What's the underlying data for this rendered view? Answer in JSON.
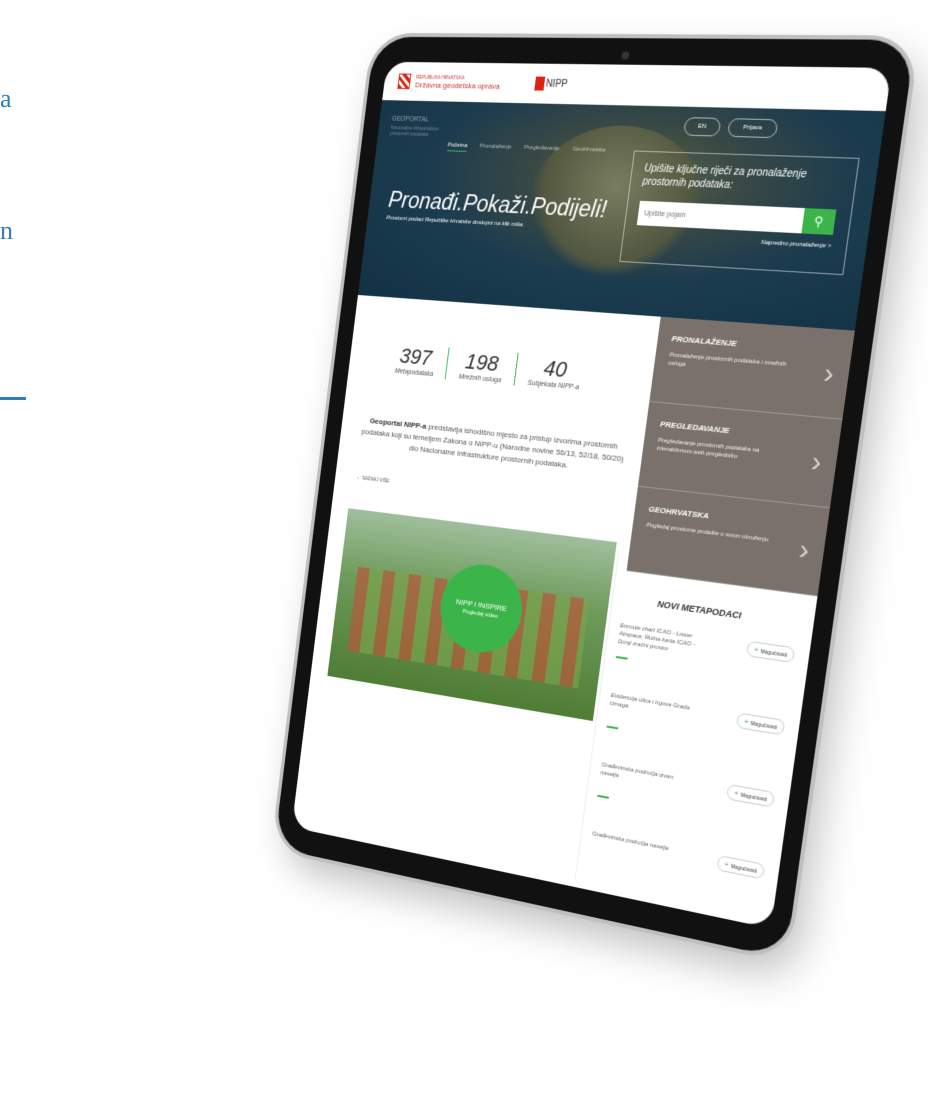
{
  "hero": {
    "gov_small": "Republika Hrvatska",
    "gov_name": "Državna geodetska uprava",
    "nipp_logo": "NIPP",
    "geo_label": "GEOPORTAL",
    "geo_sub": "Nacionalne infrastrukture prostornih podataka",
    "nav": [
      "Početna",
      "Pronalaženje",
      "Pregledavanje",
      "GeoHrvatska"
    ],
    "lang": "EN",
    "login": "Prijava",
    "slogan": "Pronađi.Pokaži.Podijeli!",
    "slogan_sub": "Prostorni podaci Republike Hrvatske dostupni na klik miša.",
    "search_title": "Upišite ključne riječi za pronalaženje prostornih podataka:",
    "search_placeholder": "Upišite pojam",
    "adv_search": "Napredno pronalaženje >"
  },
  "stats": [
    {
      "num": "397",
      "label": "Metapodataka"
    },
    {
      "num": "198",
      "label": "Mrežnih usluga"
    },
    {
      "num": "40",
      "label": "Subjekata NIPP-a"
    }
  ],
  "intro": {
    "bold": "Geoportal NIPP-a",
    "text": " predstavlja ishodišno mjesto za pristup izvorima prostornih podataka koji su temeljem Zakona o NIPP-u (Narodne novine 56/13, 52/18, 50/20) dio Nacionalne infrastrukture prostornih podataka.",
    "more": "SAZNAJ VIŠE"
  },
  "video": {
    "title": "NIPP i INSPIRE",
    "sub": "Pogledaj video"
  },
  "side": [
    {
      "title": "PRONALAŽENJE",
      "desc": "Pronalaženje prostornih podataka i mrežnih usluga"
    },
    {
      "title": "PREGLEDAVANJE",
      "desc": "Pregledavanje prostornih podataka na interaktivnom web pregledniku"
    },
    {
      "title": "GEOHRVATSKA",
      "desc": "Pogledaj prostorne podatke u svom okruženju"
    }
  ],
  "meta": {
    "title": "NOVI METAPODACI",
    "options_label": "Mogućnosti",
    "items": [
      "Enroute chart ICAO - Lower Airspace; Rutna karta ICAO - Donji zračni prostor",
      "Evidencija ulica i trgova Grada Umaga",
      "Građevinska područja izvan naselja",
      "Građevinska područja naselja"
    ]
  },
  "edge": {
    "line1": "a",
    "line2": "n"
  }
}
